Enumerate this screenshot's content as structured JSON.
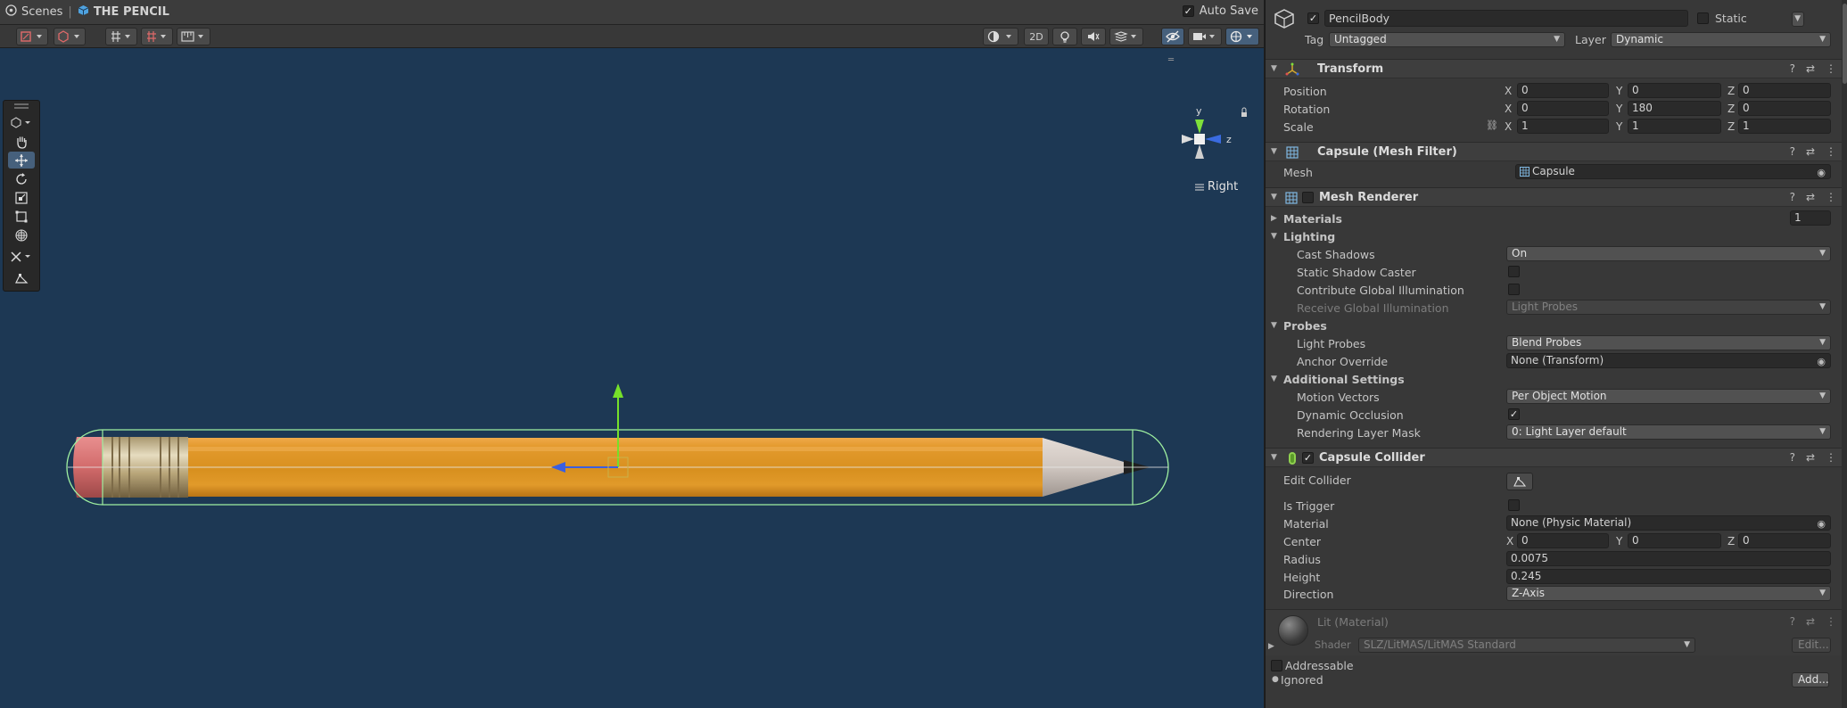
{
  "scene": {
    "breadcrumb": {
      "root": "Scenes",
      "current": "THE PENCIL"
    },
    "auto_save": {
      "label": "Auto Save",
      "checked": true
    },
    "toolbar": {
      "mode_2d": "2D"
    },
    "gizmo": {
      "y": "y",
      "z": "z",
      "view_label": "Right"
    }
  },
  "inspector": {
    "object": {
      "name": "PencilBody",
      "static_label": "Static",
      "tag_label": "Tag",
      "tag_value": "Untagged",
      "layer_label": "Layer",
      "layer_value": "Dynamic"
    },
    "transform": {
      "title": "Transform",
      "position": {
        "label": "Position",
        "x": "0",
        "y": "0",
        "z": "0"
      },
      "rotation": {
        "label": "Rotation",
        "x": "0",
        "y": "180",
        "z": "0"
      },
      "scale": {
        "label": "Scale",
        "x": "1",
        "y": "1",
        "z": "1"
      },
      "axis_x": "X",
      "axis_y": "Y",
      "axis_z": "Z"
    },
    "mesh_filter": {
      "title": "Capsule (Mesh Filter)",
      "mesh_label": "Mesh",
      "mesh_value": "Capsule"
    },
    "mesh_renderer": {
      "title": "Mesh Renderer",
      "materials_label": "Materials",
      "materials_count": "1",
      "lighting_label": "Lighting",
      "cast_shadows_label": "Cast Shadows",
      "cast_shadows_value": "On",
      "static_shadow_label": "Static Shadow Caster",
      "contribute_gi_label": "Contribute Global Illumination",
      "receive_gi_label": "Receive Global Illumination",
      "receive_gi_value": "Light Probes",
      "probes_label": "Probes",
      "light_probes_label": "Light Probes",
      "light_probes_value": "Blend Probes",
      "anchor_label": "Anchor Override",
      "anchor_value": "None (Transform)",
      "additional_label": "Additional Settings",
      "motion_vectors_label": "Motion Vectors",
      "motion_vectors_value": "Per Object Motion",
      "dynamic_occlusion_label": "Dynamic Occlusion",
      "rendering_layer_label": "Rendering Layer Mask",
      "rendering_layer_value": "0: Light Layer default"
    },
    "capsule_collider": {
      "title": "Capsule Collider",
      "edit_label": "Edit Collider",
      "is_trigger_label": "Is Trigger",
      "material_label": "Material",
      "material_value": "None (Physic Material)",
      "center_label": "Center",
      "center_x": "0",
      "center_y": "0",
      "center_z": "0",
      "radius_label": "Radius",
      "radius_value": "0.0075",
      "height_label": "Height",
      "height_value": "0.245",
      "direction_label": "Direction",
      "direction_value": "Z-Axis"
    },
    "material": {
      "title": "Lit (Material)",
      "shader_label": "Shader",
      "shader_value": "SLZ/LitMAS/LitMAS Standard",
      "edit_label": "Edit..."
    },
    "footer": {
      "addressable_label": "Addressable",
      "ignored_label": "Ignored",
      "add_label": "Add..."
    }
  }
}
